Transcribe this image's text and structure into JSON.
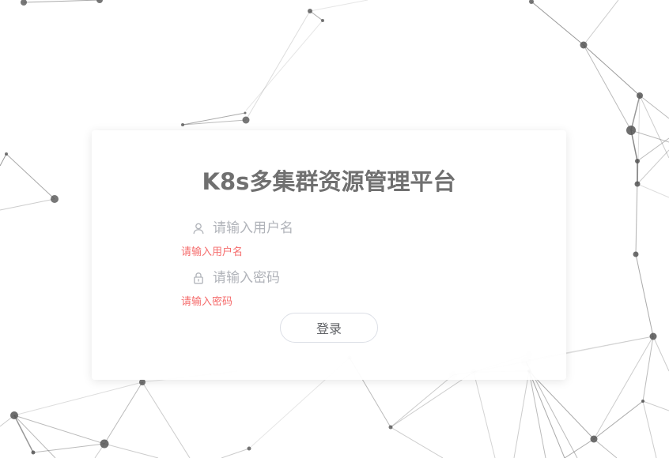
{
  "title": "K8s多集群资源管理平台",
  "form": {
    "username": {
      "value": "",
      "placeholder": "请输入用户名",
      "error": "请输入用户名",
      "icon": "user-icon"
    },
    "password": {
      "value": "",
      "placeholder": "请输入密码",
      "error": "请输入密码",
      "icon": "lock-icon"
    },
    "submit_label": "登录"
  },
  "colors": {
    "title": "#707070",
    "error": "#f56c6c",
    "placeholder": "#b0b3b9",
    "network": "#555555"
  }
}
